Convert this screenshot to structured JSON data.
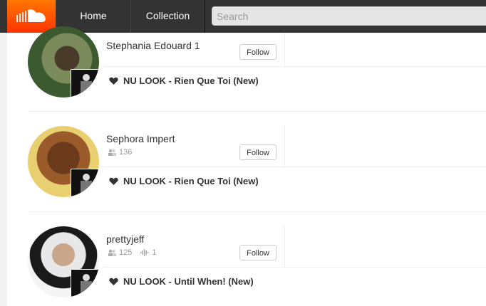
{
  "header": {
    "logo_icon": "soundcloud-cloud-icon",
    "nav": {
      "home": "Home",
      "collection": "Collection"
    },
    "search_placeholder": "Search"
  },
  "follow_label": "Follow",
  "items": [
    {
      "username": "Stephania Edouard 1",
      "followers": "",
      "tracks": "",
      "liked_track": "NU LOOK - Rien Que Toi (New)"
    },
    {
      "username": "Sephora Impert",
      "followers": "136",
      "tracks": "",
      "liked_track": "NU LOOK - Rien Que Toi (New)"
    },
    {
      "username": "prettyjeff",
      "followers": "125",
      "tracks": "1",
      "liked_track": "NU LOOK - Until When! (New)"
    }
  ],
  "colors": {
    "brand": "#ff5500",
    "header": "#333333"
  }
}
